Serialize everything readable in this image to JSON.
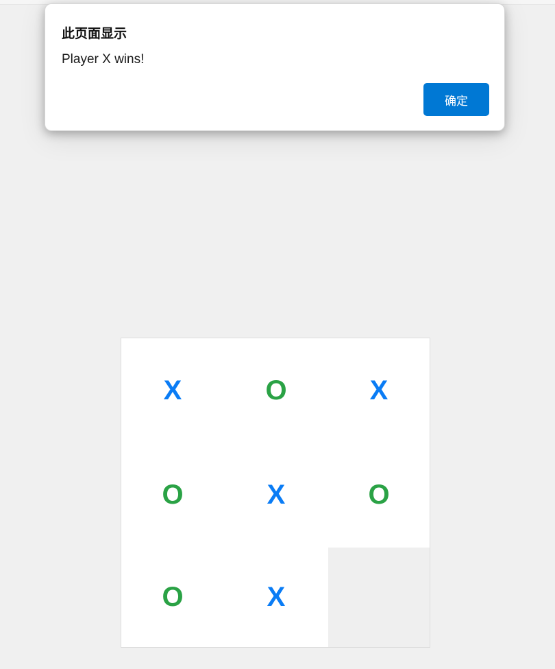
{
  "dialog": {
    "title": "此页面显示",
    "message": "Player X wins!",
    "ok_label": "确定",
    "button_color": "#0078d4"
  },
  "board": {
    "cells": [
      "X",
      "O",
      "X",
      "O",
      "X",
      "O",
      "O",
      "X",
      ""
    ],
    "colors": {
      "X": "#0a7cf5",
      "O": "#2aa245"
    }
  }
}
